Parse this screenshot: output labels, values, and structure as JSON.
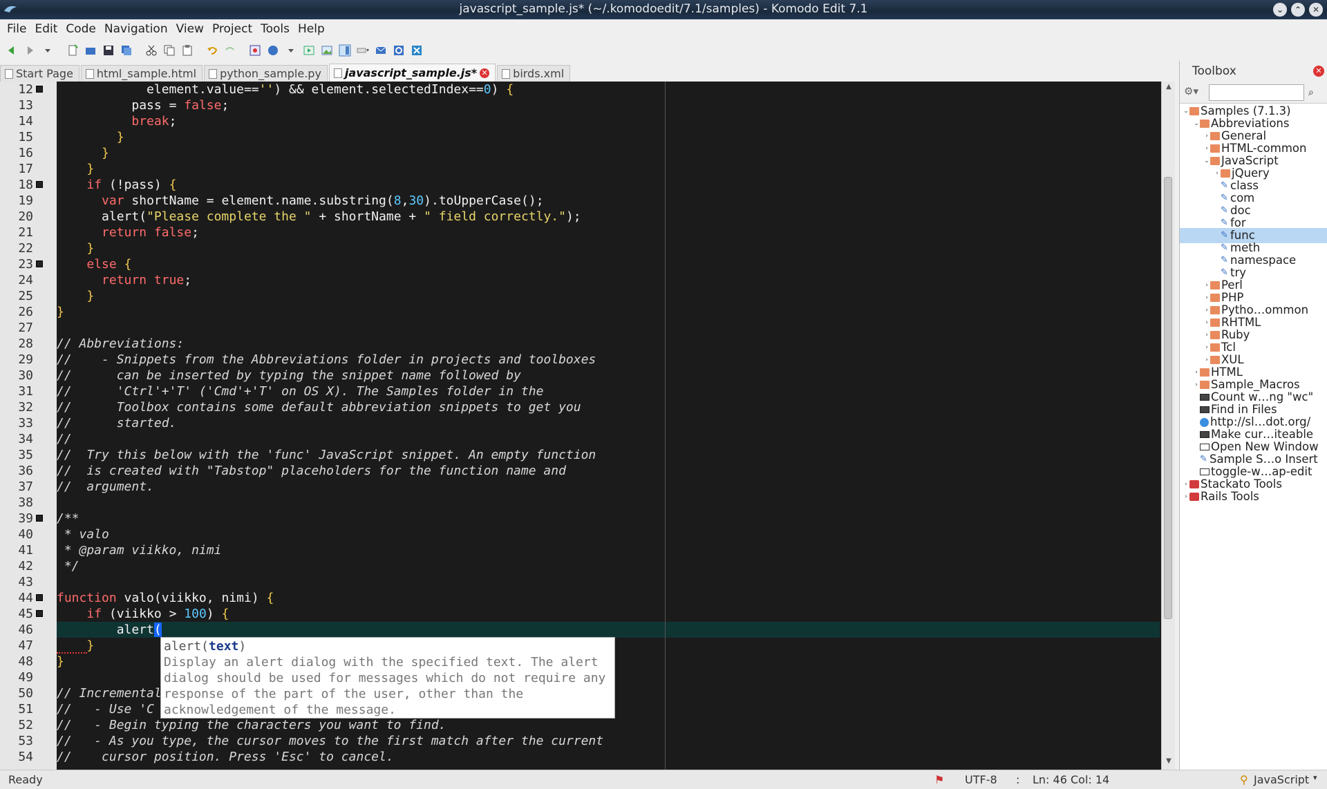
{
  "window": {
    "title": "javascript_sample.js* (~/.komodoedit/7.1/samples) - Komodo Edit 7.1"
  },
  "menubar": {
    "items": [
      {
        "label": "File"
      },
      {
        "label": "Edit"
      },
      {
        "label": "Code"
      },
      {
        "label": "Navigation"
      },
      {
        "label": "View"
      },
      {
        "label": "Project"
      },
      {
        "label": "Tools"
      },
      {
        "label": "Help"
      }
    ]
  },
  "tabs": [
    {
      "label": "Start Page"
    },
    {
      "label": "html_sample.html"
    },
    {
      "label": "python_sample.py"
    },
    {
      "label": "javascript_sample.js*",
      "active": true
    },
    {
      "label": "birds.xml"
    }
  ],
  "editor": {
    "line_numbers": [
      "12",
      "13",
      "14",
      "15",
      "16",
      "17",
      "18",
      "19",
      "20",
      "21",
      "22",
      "23",
      "24",
      "25",
      "26",
      "27",
      "28",
      "29",
      "30",
      "31",
      "32",
      "33",
      "34",
      "35",
      "36",
      "37",
      "38",
      "39",
      "40",
      "41",
      "42",
      "43",
      "44",
      "45",
      "46",
      "47",
      "48",
      "49",
      "50",
      "51",
      "52",
      "53",
      "54"
    ],
    "current_line": "46",
    "code_lines": [
      "            element.value=='') && element.selectedIndex==0) {",
      "          pass = false;",
      "          break;",
      "        }",
      "      }",
      "    }",
      "    if (!pass) {",
      "      var shortName = element.name.substring(8,30).toUpperCase();",
      "      alert(\"Please complete the \" + shortName + \" field correctly.\");",
      "      return false;",
      "    }",
      "    else {",
      "      return true;",
      "    }",
      "}",
      "",
      "// Abbreviations:",
      "//    - Snippets from the Abbreviations folder in projects and toolboxes",
      "//      can be inserted by typing the snippet name followed by",
      "//      'Ctrl'+'T' ('Cmd'+'T' on OS X). The Samples folder in the",
      "//      Toolbox contains some default abbreviation snippets to get you",
      "//      started.",
      "//",
      "//  Try this below with the 'func' JavaScript snippet. An empty function",
      "//  is created with \"Tabstop\" placeholders for the function name and",
      "//  argument.",
      "",
      "/**",
      " * valo",
      " * @param viikko, nimi",
      " */",
      "",
      "function valo(viikko, nimi) {",
      "    if (viikko > 100) {",
      "        alert(",
      "    }",
      "}",
      "",
      "// Incremental",
      "//   - Use 'C",
      "//   - Begin typing the characters you want to find.",
      "//   - As you type, the cursor moves to the first match after the current",
      "//    cursor position. Press 'Esc' to cancel."
    ]
  },
  "calltip": {
    "signature_prefix": "alert(",
    "signature_param": "text",
    "signature_suffix": ")",
    "lines": [
      "Display an alert dialog with the specified text. The alert",
      "dialog should be used for messages which do not require any",
      "response of the part of the user, other than the",
      "acknowledgement of the message."
    ]
  },
  "toolbox": {
    "title": "Toolbox",
    "search_placeholder": "",
    "tree": [
      {
        "label": "Samples (7.1.3)",
        "depth": 0,
        "icon": "folder",
        "expanded": true
      },
      {
        "label": "Abbreviations",
        "depth": 1,
        "icon": "folder",
        "expanded": true
      },
      {
        "label": "General",
        "depth": 2,
        "icon": "folder",
        "expanded": false
      },
      {
        "label": "HTML-common",
        "depth": 2,
        "icon": "folder",
        "expanded": false
      },
      {
        "label": "JavaScript",
        "depth": 2,
        "icon": "folder",
        "expanded": true
      },
      {
        "label": "jQuery",
        "depth": 3,
        "icon": "folder",
        "expanded": false
      },
      {
        "label": "class",
        "depth": 3,
        "icon": "snippet"
      },
      {
        "label": "com",
        "depth": 3,
        "icon": "snippet"
      },
      {
        "label": "doc",
        "depth": 3,
        "icon": "snippet"
      },
      {
        "label": "for",
        "depth": 3,
        "icon": "snippet"
      },
      {
        "label": "func",
        "depth": 3,
        "icon": "snippet",
        "selected": true
      },
      {
        "label": "meth",
        "depth": 3,
        "icon": "snippet"
      },
      {
        "label": "namespace",
        "depth": 3,
        "icon": "snippet"
      },
      {
        "label": "try",
        "depth": 3,
        "icon": "snippet"
      },
      {
        "label": "Perl",
        "depth": 2,
        "icon": "folder",
        "expanded": false
      },
      {
        "label": "PHP",
        "depth": 2,
        "icon": "folder",
        "expanded": false
      },
      {
        "label": "Pytho…ommon",
        "depth": 2,
        "icon": "folder",
        "expanded": false
      },
      {
        "label": "RHTML",
        "depth": 2,
        "icon": "folder",
        "expanded": false
      },
      {
        "label": "Ruby",
        "depth": 2,
        "icon": "folder",
        "expanded": false
      },
      {
        "label": "Tcl",
        "depth": 2,
        "icon": "folder",
        "expanded": false
      },
      {
        "label": "XUL",
        "depth": 2,
        "icon": "folder",
        "expanded": false
      },
      {
        "label": "HTML",
        "depth": 1,
        "icon": "folder",
        "expanded": false
      },
      {
        "label": "Sample_Macros",
        "depth": 1,
        "icon": "folder",
        "expanded": false
      },
      {
        "label": "Count w…ng \"wc\"",
        "depth": 1,
        "icon": "cmd"
      },
      {
        "label": "Find in Files",
        "depth": 1,
        "icon": "cmd"
      },
      {
        "label": "http://sl…dot.org/",
        "depth": 1,
        "icon": "url"
      },
      {
        "label": "Make cur…iteable",
        "depth": 1,
        "icon": "cmd"
      },
      {
        "label": "Open New Window",
        "depth": 1,
        "icon": "macro"
      },
      {
        "label": "Sample S…o Insert",
        "depth": 1,
        "icon": "snippet"
      },
      {
        "label": "toggle-w…ap-edit",
        "depth": 1,
        "icon": "macro"
      },
      {
        "label": "Stackato Tools",
        "depth": 0,
        "icon": "toolbox",
        "expanded": false
      },
      {
        "label": "Rails Tools",
        "depth": 0,
        "icon": "toolbox",
        "expanded": false
      }
    ]
  },
  "statusbar": {
    "status": "Ready",
    "encoding": "UTF-8",
    "position": "Ln: 46 Col: 14",
    "language": "JavaScript"
  },
  "colors": {
    "editor_bg": "#1b1b1b",
    "keyword": "#ff6b6b",
    "string": "#e8d66a",
    "number": "#5cc9ff",
    "current_line": "#0f3533",
    "selection": "#b9d7f3"
  }
}
